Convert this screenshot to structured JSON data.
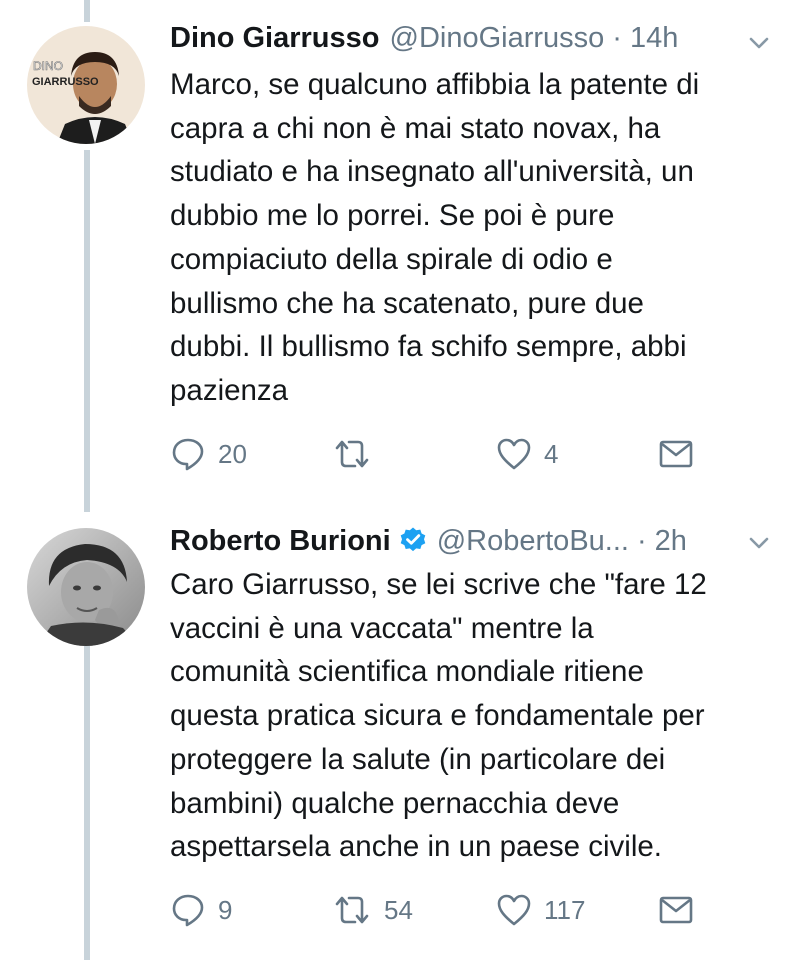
{
  "tweets": [
    {
      "name": "Dino Giarrusso",
      "handle": "@DinoGiarrusso",
      "separator": "·",
      "time": "14h",
      "avatar_text": {
        "line1": "DINO",
        "line2": "GIARRUSSO"
      },
      "verified": false,
      "lines": [
        "Marco, se qualcuno affibbia la patente di",
        "capra a chi non è mai stato novax, ha",
        "studiato e ha insegnato all'università, un",
        "dubbio me lo porrei. Se poi è pure",
        "compiaciuto della spirale di odio e",
        "bullismo che ha scatenato, pure due",
        "dubbi. Il bullismo fa schifo sempre, abbi",
        "pazienza"
      ],
      "replies": "20",
      "retweets": "",
      "likes": "4"
    },
    {
      "name": "Roberto Burioni",
      "handle": "@RobertoBu...",
      "separator": "·",
      "time": "2h",
      "verified": true,
      "lines": [
        "Caro Giarrusso, se lei scrive che \"fare 12",
        "vaccini è una vaccata\" mentre la",
        "comunità scientifica mondiale ritiene",
        "questa pratica sicura e fondamentale per",
        "proteggere la salute (in particolare dei",
        "bambini) qualche pernacchia deve",
        "aspettarsela anche in un paese civile."
      ],
      "replies": "9",
      "retweets": "54",
      "likes": "117"
    }
  ],
  "colors": {
    "text": "#14171a",
    "muted": "#657786",
    "verified": "#1da1f2",
    "thread_line": "#c8d3da"
  },
  "icons": [
    "reply-icon",
    "retweet-icon",
    "like-icon",
    "dm-icon",
    "chevron-down-icon",
    "verified-badge-icon"
  ]
}
